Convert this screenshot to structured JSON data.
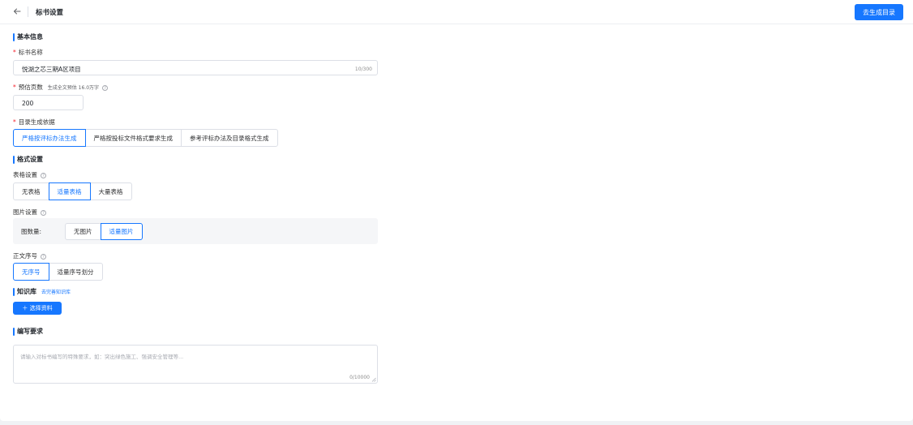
{
  "header": {
    "back_icon": "arrow-left-icon",
    "title": "标书设置",
    "generate_button": "去生成目录"
  },
  "basic_info": {
    "section_title": "基本信息",
    "name_label": "标书名称",
    "name_value": "悦湖之芯三期A区项目",
    "name_counter": "10/300",
    "pages_label": "预估页数",
    "pages_hint": "生成全文预估 16.0万字",
    "pages_value": "200",
    "basis_label": "目录生成依据",
    "basis_options": [
      "严格按评标办法生成",
      "严格按投标文件格式要求生成",
      "参考评标办法及目录格式生成"
    ],
    "basis_selected": 0
  },
  "format": {
    "section_title": "格式设置",
    "table_label": "表格设置",
    "table_options": [
      "无表格",
      "适量表格",
      "大量表格"
    ],
    "table_selected": 1,
    "image_label": "图片设置",
    "image_count_label": "图数量:",
    "image_options": [
      "无图片",
      "适量图片"
    ],
    "image_selected": 1,
    "numbering_label": "正文序号",
    "numbering_options": [
      "无序号",
      "适量序号划分"
    ],
    "numbering_selected": 0
  },
  "knowledge": {
    "section_title": "知识库",
    "link": "去完善知识库",
    "select_button": "选择资料"
  },
  "requirements": {
    "section_title": "编写要求",
    "placeholder": "请输入对标书编写的特殊要求，如：突出绿色施工、强调安全管理等...",
    "counter": "0/10000"
  },
  "colors": {
    "primary": "#1677ff",
    "required": "#f5222d",
    "border": "#dcdfe6"
  }
}
